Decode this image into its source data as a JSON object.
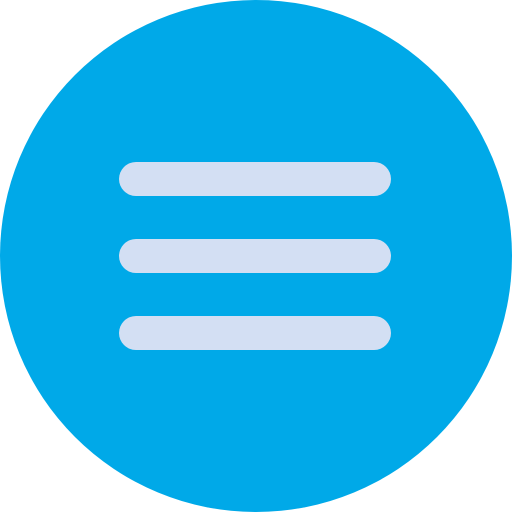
{
  "icon": {
    "name": "hamburger-menu-icon",
    "shape": "circle",
    "bar_count": 3
  },
  "colors": {
    "circle_fill": "#00A9E8",
    "bar_fill": "#D3DFF3",
    "background": "#FFFFFF"
  }
}
